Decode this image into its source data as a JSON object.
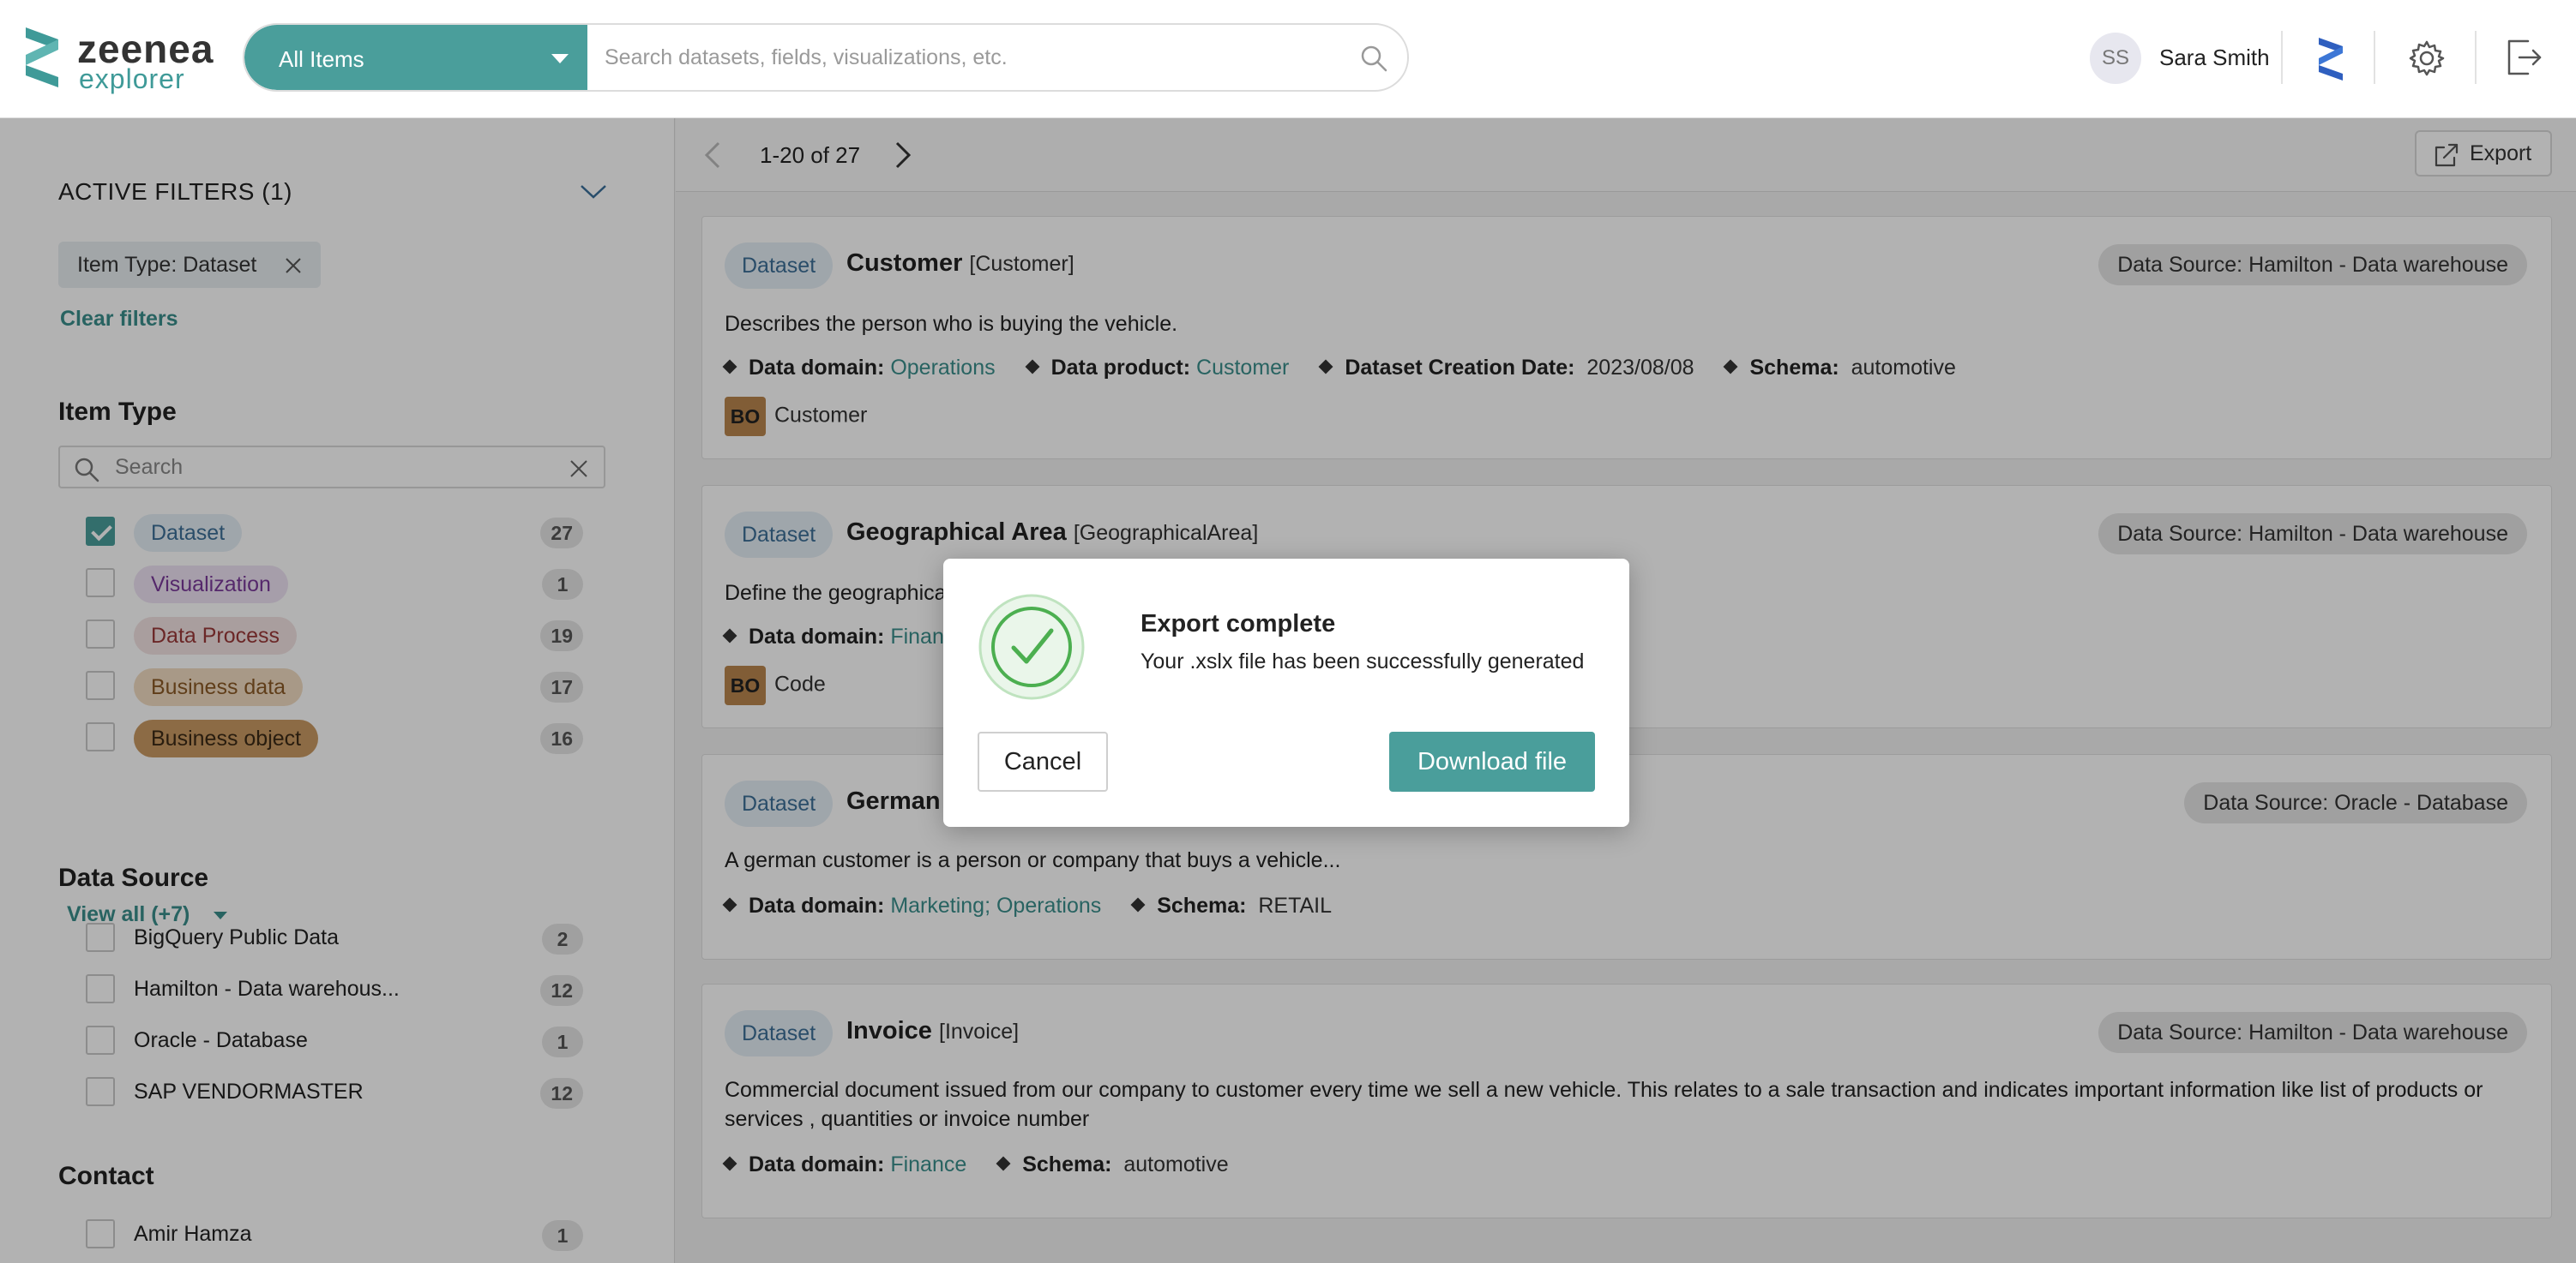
{
  "app": {
    "logo_line1": "zeenea",
    "logo_line2": "explorer"
  },
  "search": {
    "type_label": "All Items",
    "placeholder": "Search datasets, fields, visualizations, etc."
  },
  "user": {
    "initials": "SS",
    "name": "Sara Smith"
  },
  "sidebar": {
    "active_filters_title": "ACTIVE FILTERS (1)",
    "active_chip": "Item Type: Dataset",
    "clear_filters": "Clear filters",
    "item_type": {
      "title": "Item Type",
      "search_placeholder": "Search",
      "items": [
        {
          "label": "Dataset",
          "count": "27",
          "checked": true,
          "bg": "#e4eef5",
          "fg": "#3d6f97"
        },
        {
          "label": "Visualization",
          "count": "1",
          "checked": false,
          "bg": "#eee3f4",
          "fg": "#7a3a9a"
        },
        {
          "label": "Data Process",
          "count": "19",
          "checked": false,
          "bg": "#f2e2e2",
          "fg": "#9a3838"
        },
        {
          "label": "Business data",
          "count": "17",
          "checked": false,
          "bg": "#f1dcc2",
          "fg": "#8a5a26"
        },
        {
          "label": "Business object",
          "count": "16",
          "checked": false,
          "bg": "#c99a63",
          "fg": "#3c2a16"
        }
      ],
      "view_all": "View all (+7)"
    },
    "data_source": {
      "title": "Data Source",
      "items": [
        {
          "label": "BigQuery Public Data",
          "count": "2"
        },
        {
          "label": "Hamilton - Data warehous...",
          "count": "12"
        },
        {
          "label": "Oracle - Database",
          "count": "1"
        },
        {
          "label": "SAP VENDORMASTER",
          "count": "12"
        }
      ]
    },
    "contact": {
      "title": "Contact",
      "items": [
        {
          "label": "Amir Hamza",
          "count": "1"
        }
      ]
    }
  },
  "main": {
    "pager_text": "1-20 of 27",
    "export_label": "Export",
    "results": [
      {
        "type": "Dataset",
        "name": "Customer",
        "technical": "[Customer]",
        "source": "Data Source:  Hamilton - Data warehouse",
        "description": "Describes the person who is buying the vehicle.",
        "meta": {
          "domain_label": "Data domain:",
          "domain_value": "Operations",
          "product_label": "Data product:",
          "product_value": "Customer",
          "date_label": "Dataset Creation Date:",
          "date_value": "2023/08/08",
          "schema_label": "Schema:",
          "schema_value": "automotive"
        },
        "bo_badge": "BO",
        "bo_label": "Customer"
      },
      {
        "type": "Dataset",
        "name": "Geographical Area",
        "technical": "[GeographicalArea]",
        "source": "Data Source:  Hamilton - Data warehouse",
        "description": "Define the geographica",
        "meta": {
          "domain_label": "Data domain:",
          "domain_value": "Finan"
        },
        "bo_badge": "BO",
        "bo_label": "Code"
      },
      {
        "type": "Dataset",
        "name": "German",
        "technical": "",
        "source": "Data Source:  Oracle - Database",
        "description": "A german customer is a person or company that buys a vehicle...",
        "meta": {
          "domain_label": "Data domain:",
          "domain_value": "Marketing; Operations",
          "schema_label": "Schema:",
          "schema_value": "RETAIL"
        }
      },
      {
        "type": "Dataset",
        "name": "Invoice",
        "technical": "[Invoice]",
        "source": "Data Source:  Hamilton - Data warehouse",
        "description": "Commercial document issued from our company to customer every time we sell a new vehicle. This relates to a sale transaction and indicates important information like list of products or services , quantities or invoice number",
        "meta": {
          "domain_label": "Data domain:",
          "domain_value": "Finance",
          "schema_label": "Schema:",
          "schema_value": "automotive"
        }
      }
    ]
  },
  "modal": {
    "title": "Export complete",
    "message": "Your .xslx file has been successfully generated",
    "cancel_label": "Cancel",
    "download_label": "Download file"
  },
  "colors": {
    "accent": "#4a9e9b",
    "link": "#3a8e8c",
    "success": "#4caf50"
  }
}
